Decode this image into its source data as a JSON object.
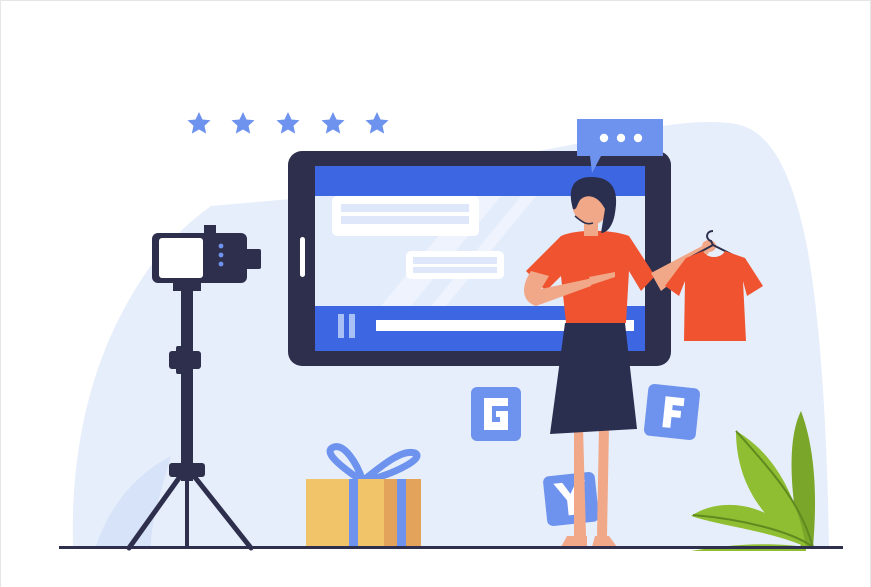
{
  "illustration": {
    "rating_stars": 5,
    "social_icon_letters": [
      "G",
      "F",
      "Y"
    ],
    "icons": [
      "camera-on-tripod-icon",
      "tablet-video-player-icon",
      "speech-bubble-icon",
      "gift-box-icon",
      "plant-icon",
      "star-icon",
      "tshirt-on-hanger-icon"
    ],
    "colors": {
      "background_blob": "#e6eefb",
      "tablet_frame": "#2d2f4c",
      "tablet_screen": "#3d66e3",
      "accent_blue": "#6e93ee",
      "shirt_orange": "#f0532f",
      "skirt_navy": "#2b2f4f",
      "gift_yellow": "#f1c46a",
      "leaf_green": "#8fbe32",
      "ground_line": "#2d2f4c"
    }
  }
}
